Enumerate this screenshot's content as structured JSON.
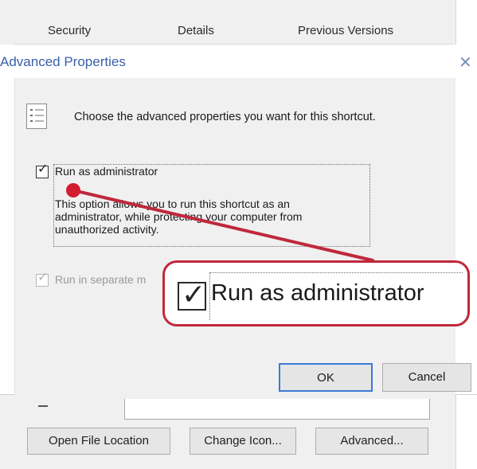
{
  "tabs": [
    "Security",
    "Details",
    "Previous Versions"
  ],
  "dialog": {
    "title": "Advanced Properties",
    "close_glyph": "✕",
    "instruction": "Choose the advanced properties you want for this shortcut.",
    "list_icon": "list-icon",
    "run_as_admin": {
      "label": "Run as administrator",
      "checked": true,
      "description": "This option allows you to run this shortcut as an\nadministrator, while protecting your computer from\nunauthorized activity."
    },
    "run_separate": {
      "label": "Run in separate m",
      "checked": true,
      "enabled": false
    },
    "ok_label": "OK",
    "cancel_label": "Cancel"
  },
  "callout": {
    "label": "Run as administrator",
    "checked": true,
    "color": "#c0283c"
  },
  "background_buttons": {
    "open_file_location": "Open File Location",
    "change_icon": "Change Icon...",
    "advanced": "Advanced..."
  },
  "check_glyph": "✓"
}
